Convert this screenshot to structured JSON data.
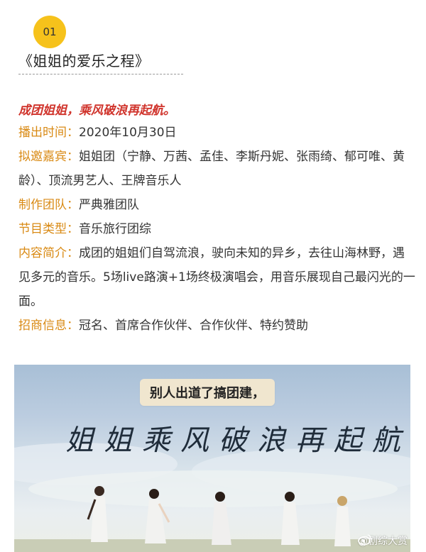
{
  "section": {
    "number": "01",
    "title": "《姐姐的爱乐之程》"
  },
  "slogan": "成团姐姐，乘风破浪再起航。",
  "info": [
    {
      "label": "播出时间：",
      "value": "2020年10月30日"
    },
    {
      "label": "拟邀嘉宾：",
      "value": "姐姐团（宁静、万茜、孟佳、李斯丹妮、张雨绮、郁可唯、黄龄）、顶流男艺人、王牌音乐人"
    },
    {
      "label": "制作团队：",
      "value": "严典雅团队"
    },
    {
      "label": "节目类型：",
      "value": "音乐旅行团综"
    },
    {
      "label": "内容简介：",
      "value": "成团的姐姐们自驾流浪，驶向未知的异乡，去往山海林野，遇见多元的音乐。5场live路演+1场终极演唱会，用音乐展现自己最闪光的一面。"
    },
    {
      "label": "招商信息：",
      "value": "冠名、首席合作伙伴、合作伙伴、特约赞助"
    }
  ],
  "poster": {
    "caption": "别人出道了搞团建，",
    "headline": "姐姐乘风破浪再起航"
  },
  "watermark": "@剧综大赏",
  "colors": {
    "badge": "#f6c21b",
    "slogan": "#d0342c",
    "label": "#d98a14"
  }
}
